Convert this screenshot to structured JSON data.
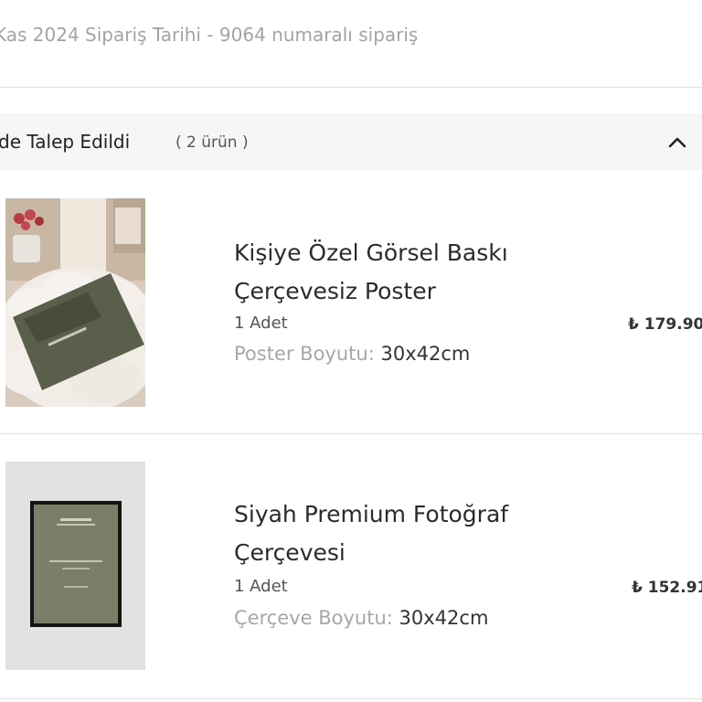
{
  "order": {
    "meta": "Kas 2024 Sipariş Tarihi - 9064 numaralı sipariş"
  },
  "group": {
    "title": "de Talep Edildi",
    "count": "( 2 ürün )"
  },
  "items": [
    {
      "name_line1": "Kişiye Özel Görsel Baskı",
      "name_line2": "Çerçevesiz Poster",
      "qty": "1 Adet",
      "option_label": "Poster Boyutu:",
      "option_value": "30x42cm",
      "price": "₺ 179.90"
    },
    {
      "name_line1": "Siyah Premium Fotoğraf",
      "name_line2": "Çerçevesi",
      "qty": "1 Adet",
      "option_label": "Çerçeve Boyutu:",
      "option_value": "30x42cm",
      "price": "₺ 152.91"
    }
  ],
  "icons": {
    "collapse": "chevron-up-icon"
  }
}
